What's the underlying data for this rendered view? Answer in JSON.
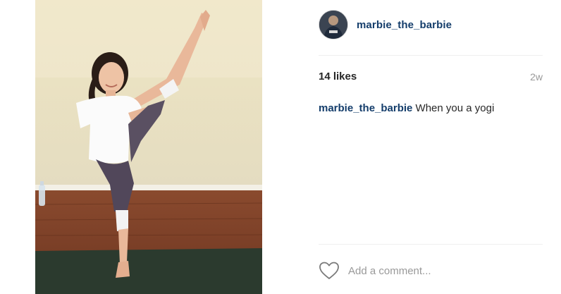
{
  "post": {
    "image_alt": "Woman in white t-shirt and leggings doing a standing yoga pose with one leg raised high, indoors on a wooden floor and dark yoga mat"
  },
  "header": {
    "username": "marbie_the_barbie"
  },
  "stats": {
    "likes": "14 likes",
    "time": "2w"
  },
  "caption": {
    "username": "marbie_the_barbie",
    "text": " When you a yogi"
  },
  "comment": {
    "placeholder": "Add a comment..."
  },
  "colors": {
    "username": "#143d6b",
    "muted": "#999999",
    "text": "#262626",
    "divider": "#efefef"
  },
  "icons": {
    "like": "heart-outline-icon"
  }
}
